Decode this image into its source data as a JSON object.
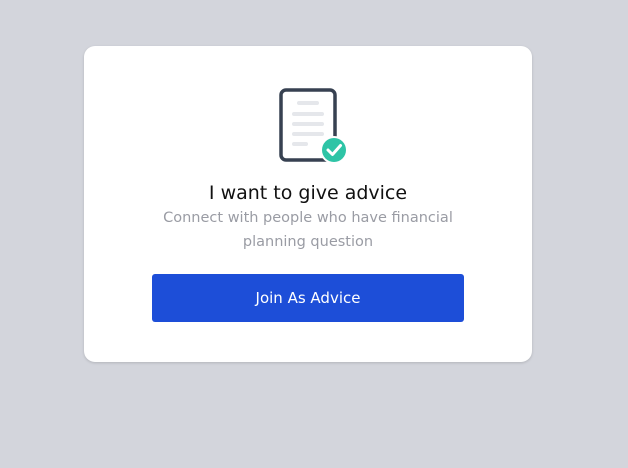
{
  "card": {
    "icon": "document-check-icon",
    "title": "I want to give advice",
    "description": "Connect with people who have financial planning question",
    "button_label": "Join As Advice"
  },
  "colors": {
    "background": "#d3d5dc",
    "card": "#ffffff",
    "button": "#1d4ed8",
    "check": "#2ec4a6",
    "icon_outline": "#374151",
    "description_text": "#9a9ca4"
  }
}
